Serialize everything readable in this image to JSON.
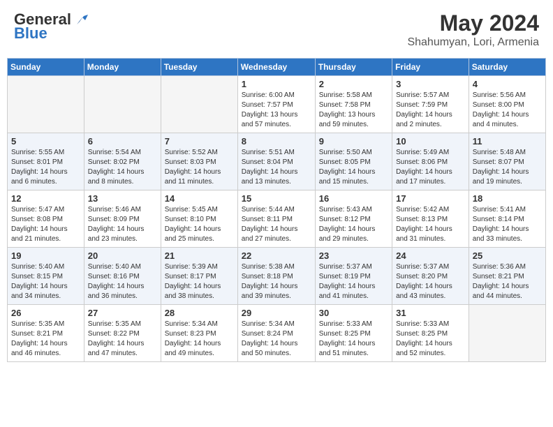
{
  "header": {
    "logo_general": "General",
    "logo_blue": "Blue",
    "title": "May 2024",
    "subtitle": "Shahumyan, Lori, Armenia"
  },
  "days_of_week": [
    "Sunday",
    "Monday",
    "Tuesday",
    "Wednesday",
    "Thursday",
    "Friday",
    "Saturday"
  ],
  "weeks": [
    [
      {
        "day": "",
        "info": ""
      },
      {
        "day": "",
        "info": ""
      },
      {
        "day": "",
        "info": ""
      },
      {
        "day": "1",
        "info": "Sunrise: 6:00 AM\nSunset: 7:57 PM\nDaylight: 13 hours\nand 57 minutes."
      },
      {
        "day": "2",
        "info": "Sunrise: 5:58 AM\nSunset: 7:58 PM\nDaylight: 13 hours\nand 59 minutes."
      },
      {
        "day": "3",
        "info": "Sunrise: 5:57 AM\nSunset: 7:59 PM\nDaylight: 14 hours\nand 2 minutes."
      },
      {
        "day": "4",
        "info": "Sunrise: 5:56 AM\nSunset: 8:00 PM\nDaylight: 14 hours\nand 4 minutes."
      }
    ],
    [
      {
        "day": "5",
        "info": "Sunrise: 5:55 AM\nSunset: 8:01 PM\nDaylight: 14 hours\nand 6 minutes."
      },
      {
        "day": "6",
        "info": "Sunrise: 5:54 AM\nSunset: 8:02 PM\nDaylight: 14 hours\nand 8 minutes."
      },
      {
        "day": "7",
        "info": "Sunrise: 5:52 AM\nSunset: 8:03 PM\nDaylight: 14 hours\nand 11 minutes."
      },
      {
        "day": "8",
        "info": "Sunrise: 5:51 AM\nSunset: 8:04 PM\nDaylight: 14 hours\nand 13 minutes."
      },
      {
        "day": "9",
        "info": "Sunrise: 5:50 AM\nSunset: 8:05 PM\nDaylight: 14 hours\nand 15 minutes."
      },
      {
        "day": "10",
        "info": "Sunrise: 5:49 AM\nSunset: 8:06 PM\nDaylight: 14 hours\nand 17 minutes."
      },
      {
        "day": "11",
        "info": "Sunrise: 5:48 AM\nSunset: 8:07 PM\nDaylight: 14 hours\nand 19 minutes."
      }
    ],
    [
      {
        "day": "12",
        "info": "Sunrise: 5:47 AM\nSunset: 8:08 PM\nDaylight: 14 hours\nand 21 minutes."
      },
      {
        "day": "13",
        "info": "Sunrise: 5:46 AM\nSunset: 8:09 PM\nDaylight: 14 hours\nand 23 minutes."
      },
      {
        "day": "14",
        "info": "Sunrise: 5:45 AM\nSunset: 8:10 PM\nDaylight: 14 hours\nand 25 minutes."
      },
      {
        "day": "15",
        "info": "Sunrise: 5:44 AM\nSunset: 8:11 PM\nDaylight: 14 hours\nand 27 minutes."
      },
      {
        "day": "16",
        "info": "Sunrise: 5:43 AM\nSunset: 8:12 PM\nDaylight: 14 hours\nand 29 minutes."
      },
      {
        "day": "17",
        "info": "Sunrise: 5:42 AM\nSunset: 8:13 PM\nDaylight: 14 hours\nand 31 minutes."
      },
      {
        "day": "18",
        "info": "Sunrise: 5:41 AM\nSunset: 8:14 PM\nDaylight: 14 hours\nand 33 minutes."
      }
    ],
    [
      {
        "day": "19",
        "info": "Sunrise: 5:40 AM\nSunset: 8:15 PM\nDaylight: 14 hours\nand 34 minutes."
      },
      {
        "day": "20",
        "info": "Sunrise: 5:40 AM\nSunset: 8:16 PM\nDaylight: 14 hours\nand 36 minutes."
      },
      {
        "day": "21",
        "info": "Sunrise: 5:39 AM\nSunset: 8:17 PM\nDaylight: 14 hours\nand 38 minutes."
      },
      {
        "day": "22",
        "info": "Sunrise: 5:38 AM\nSunset: 8:18 PM\nDaylight: 14 hours\nand 39 minutes."
      },
      {
        "day": "23",
        "info": "Sunrise: 5:37 AM\nSunset: 8:19 PM\nDaylight: 14 hours\nand 41 minutes."
      },
      {
        "day": "24",
        "info": "Sunrise: 5:37 AM\nSunset: 8:20 PM\nDaylight: 14 hours\nand 43 minutes."
      },
      {
        "day": "25",
        "info": "Sunrise: 5:36 AM\nSunset: 8:21 PM\nDaylight: 14 hours\nand 44 minutes."
      }
    ],
    [
      {
        "day": "26",
        "info": "Sunrise: 5:35 AM\nSunset: 8:21 PM\nDaylight: 14 hours\nand 46 minutes."
      },
      {
        "day": "27",
        "info": "Sunrise: 5:35 AM\nSunset: 8:22 PM\nDaylight: 14 hours\nand 47 minutes."
      },
      {
        "day": "28",
        "info": "Sunrise: 5:34 AM\nSunset: 8:23 PM\nDaylight: 14 hours\nand 49 minutes."
      },
      {
        "day": "29",
        "info": "Sunrise: 5:34 AM\nSunset: 8:24 PM\nDaylight: 14 hours\nand 50 minutes."
      },
      {
        "day": "30",
        "info": "Sunrise: 5:33 AM\nSunset: 8:25 PM\nDaylight: 14 hours\nand 51 minutes."
      },
      {
        "day": "31",
        "info": "Sunrise: 5:33 AM\nSunset: 8:25 PM\nDaylight: 14 hours\nand 52 minutes."
      },
      {
        "day": "",
        "info": ""
      }
    ]
  ]
}
